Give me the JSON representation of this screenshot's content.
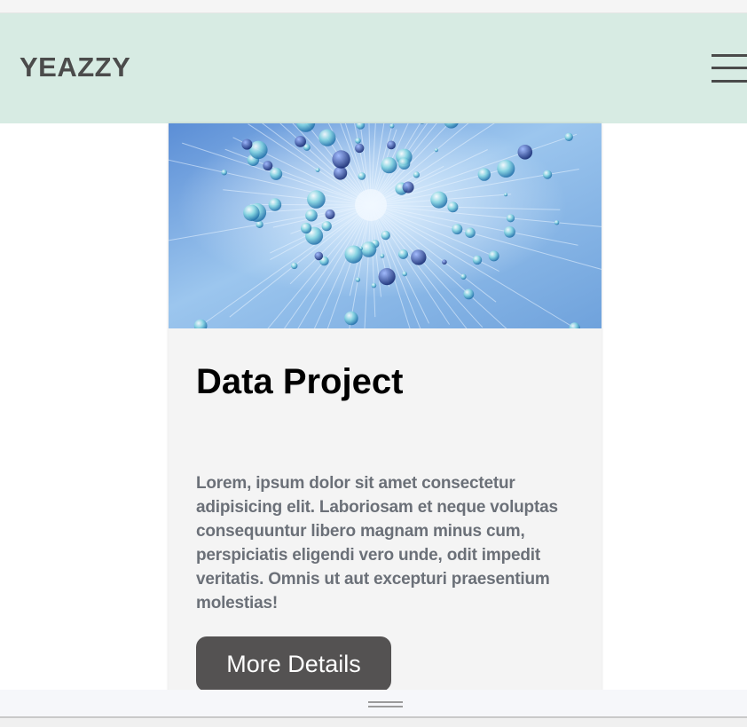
{
  "navbar": {
    "brand": "YEAZZY",
    "menu_icon": "hamburger-menu-icon",
    "background": "#d7ebe3"
  },
  "card": {
    "image_alt": "",
    "title": "Data Project",
    "text": "Lorem, ipsum dolor sit amet consectetur adipisicing elit. Laboriosam et neque voluptas consequuntur libero magnam minus cum, perspiciatis eligendi vero unde, odit impedit veritatis. Omnis ut aut excepturi praesentium molestias!",
    "button_label": "More Details",
    "button_color": "#545252"
  },
  "footer": {
    "handle_icon": "drag-handle-icon"
  }
}
